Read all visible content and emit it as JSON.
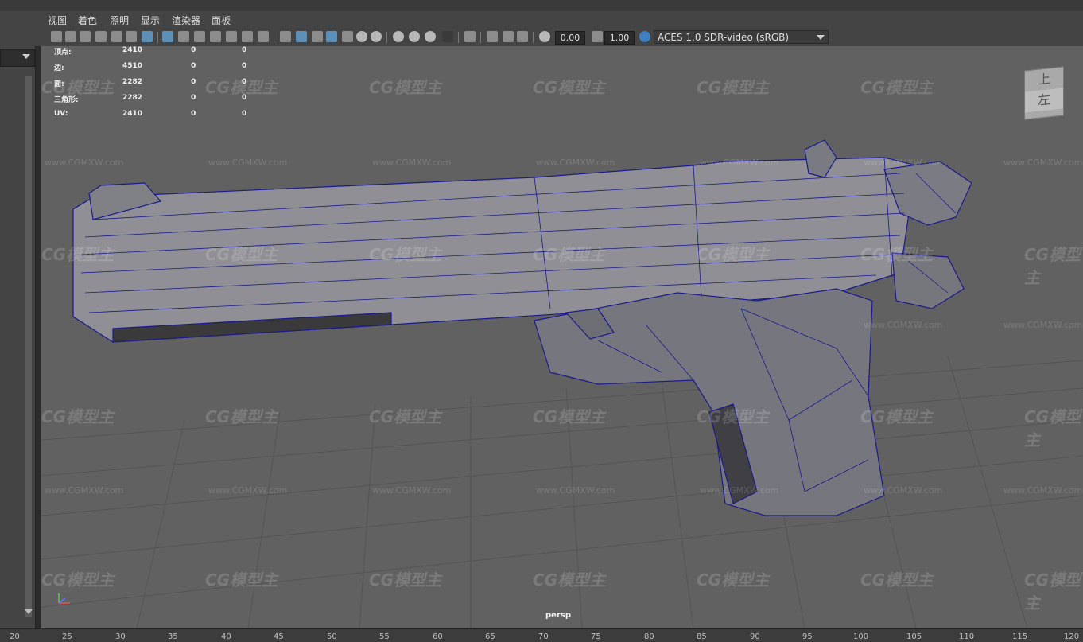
{
  "menu": [
    "视图",
    "着色",
    "照明",
    "显示",
    "渲染器",
    "面板"
  ],
  "toolbar": {
    "exposure": "0.00",
    "gamma": "1.00",
    "color_space": "ACES 1.0 SDR-video (sRGB)"
  },
  "hud": {
    "rows": [
      {
        "label": "顶点:",
        "v1": "2410",
        "v2": "0",
        "v3": "0"
      },
      {
        "label": "边:",
        "v1": "4510",
        "v2": "0",
        "v3": "0"
      },
      {
        "label": "面:",
        "v1": "2282",
        "v2": "0",
        "v3": "0"
      },
      {
        "label": "三角形:",
        "v1": "2282",
        "v2": "0",
        "v3": "0"
      },
      {
        "label": "UV:",
        "v1": "2410",
        "v2": "0",
        "v3": "0"
      }
    ]
  },
  "viewcube": {
    "top": "上",
    "left": "左"
  },
  "viewport_label": "persp",
  "watermark": {
    "text": "CG模型主",
    "url": "www.CGMXW.com"
  },
  "ruler": [
    "20",
    "25",
    "30",
    "35",
    "40",
    "45",
    "50",
    "55",
    "60",
    "65",
    "70",
    "75",
    "80",
    "85",
    "90",
    "95",
    "100",
    "105",
    "110",
    "115",
    "120"
  ],
  "colors": {
    "wireframe": "#1a1a8c",
    "selection": "#5e8fb6",
    "viewport_bg": "#616161"
  },
  "icons": [
    "camera-icon",
    "wireframe-icon",
    "smooth-shade-icon",
    "textured-icon",
    "lights-icon",
    "shadows-icon",
    "isolate-icon",
    "xray-icon",
    "grid-icon",
    "resolution-gate-icon",
    "color-management-icon"
  ]
}
